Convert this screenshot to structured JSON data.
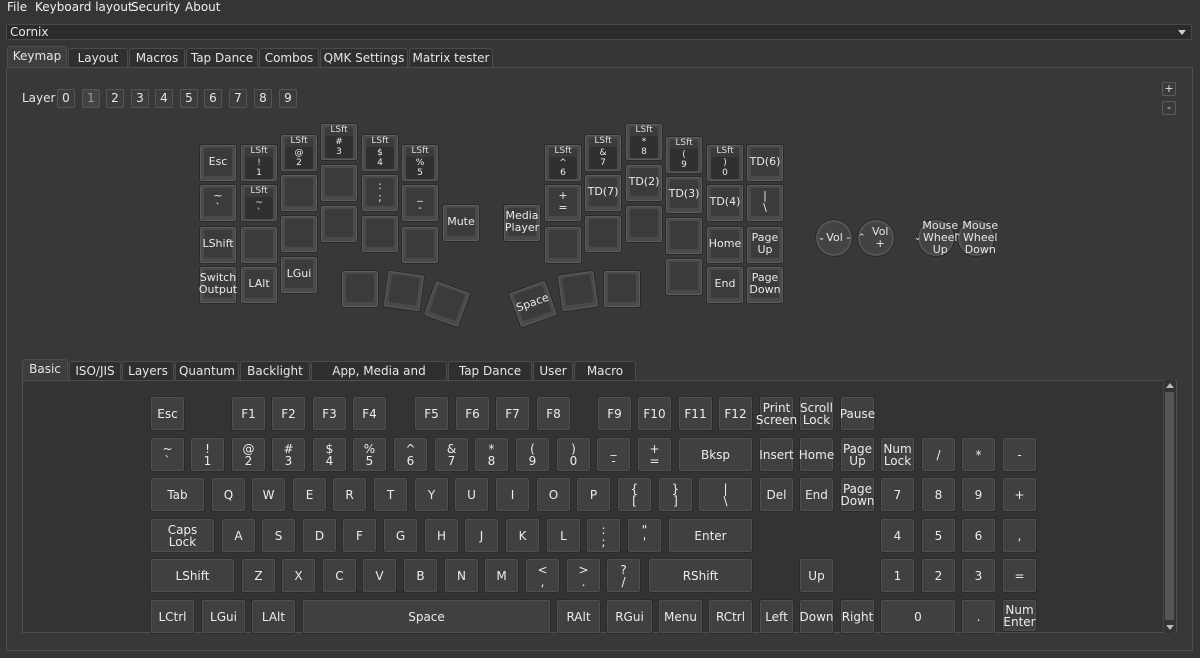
{
  "menu": [
    "File",
    "Keyboard layout",
    "Security",
    "About"
  ],
  "device": "Cornix",
  "top_tabs": [
    "Keymap",
    "Layout",
    "Macros",
    "Tap Dance",
    "Combos",
    "QMK Settings",
    "Matrix tester"
  ],
  "layer_label": "Layer",
  "layers": [
    "0",
    "1",
    "2",
    "3",
    "4",
    "5",
    "6",
    "7",
    "8",
    "9"
  ],
  "zoom_in": "+",
  "zoom_out": "-",
  "layout_keys": {
    "esc": "Esc",
    "lsft_1_mod": "LSft",
    "lsft_1_in": "!\n1",
    "lsft_2_mod": "LSft",
    "lsft_2_in": "@\n2",
    "lsft_3_mod": "LSft",
    "lsft_3_in": "#\n3",
    "lsft_4_mod": "LSft",
    "lsft_4_in": "$\n4",
    "lsft_5_mod": "LSft",
    "lsft_5_in": "%\n5",
    "grave": "~\n`",
    "lsft_grave_mod": "LSft",
    "lsft_grave_in": "~\n`",
    "semicolon": ":\n;",
    "minus": "_\n-",
    "lshift": "LShift",
    "switch_output": "Switch\nOutput",
    "lalt": "LAlt",
    "lgui": "LGui",
    "mute": "Mute",
    "media_player": "Media\nPlayer",
    "lsft_6_mod": "LSft",
    "lsft_6_in": "^\n6",
    "lsft_7_mod": "LSft",
    "lsft_7_in": "&\n7",
    "lsft_8_mod": "LSft",
    "lsft_8_in": "*\n8",
    "lsft_9_mod": "LSft",
    "lsft_9_in": "(\n9",
    "lsft_0_mod": "LSft",
    "lsft_0_in": ")\n0",
    "td6": "TD(6)",
    "equal": "+\n=",
    "td7": "TD(7)",
    "td2": "TD(2)",
    "td3": "TD(3)",
    "td4": "TD(4)",
    "backslash": "|\n\\",
    "home": "Home",
    "page_up": "Page\nUp",
    "end": "End",
    "page_down": "Page\nDown",
    "space": "Space",
    "enc_vol_down": "Vol -",
    "enc_vol_up": "Vol +",
    "enc_wheel_up": "Mouse\nWheel\nUp",
    "enc_wheel_down": "Mouse\nWheel\nDown"
  },
  "bottom_tabs": [
    "Basic",
    "ISO/JIS",
    "Layers",
    "Quantum",
    "Backlight",
    "App, Media and Mouse",
    "Tap Dance",
    "User",
    "Macro"
  ],
  "basic_keys": {
    "esc": "Esc",
    "f1": "F1",
    "f2": "F2",
    "f3": "F3",
    "f4": "F4",
    "f5": "F5",
    "f6": "F6",
    "f7": "F7",
    "f8": "F8",
    "f9": "F9",
    "f10": "F10",
    "f11": "F11",
    "f12": "F12",
    "print_screen": "Print\nScreen",
    "scroll_lock": "Scroll\nLock",
    "pause": "Pause",
    "grave": "~\n`",
    "k1": "!\n1",
    "k2": "@\n2",
    "k3": "#\n3",
    "k4": "$\n4",
    "k5": "%\n5",
    "k6": "^\n6",
    "k7": "&\n7",
    "k8": "*\n8",
    "k9": "(\n9",
    "k0": ")\n0",
    "minus": "_\n-",
    "equal": "+\n=",
    "bksp": "Bksp",
    "insert": "Insert",
    "home": "Home",
    "page_up": "Page\nUp",
    "num_lock": "Num\nLock",
    "kp_slash": "/",
    "kp_star": "*",
    "kp_minus": "-",
    "tab": "Tab",
    "q": "Q",
    "w": "W",
    "e": "E",
    "r": "R",
    "t": "T",
    "y": "Y",
    "u": "U",
    "i": "I",
    "o": "O",
    "p": "P",
    "lbracket": "{\n[",
    "rbracket": "}\n]",
    "backslash": "|\n\\",
    "del": "Del",
    "end": "End",
    "page_down": "Page\nDown",
    "kp7": "7",
    "kp8": "8",
    "kp9": "9",
    "kp_plus": "+",
    "caps_lock": "Caps\nLock",
    "a": "A",
    "s": "S",
    "d": "D",
    "f": "F",
    "g": "G",
    "h": "H",
    "j": "J",
    "k": "K",
    "l": "L",
    "semicolon": ":\n;",
    "quote": "\"\n'",
    "enter": "Enter",
    "kp4": "4",
    "kp5": "5",
    "kp6": "6",
    "kp_comma": ",",
    "lshift": "LShift",
    "z": "Z",
    "x": "X",
    "c": "C",
    "v": "V",
    "b": "B",
    "n": "N",
    "m": "M",
    "comma": "<\n,",
    "period": ">\n.",
    "slash": "?\n/",
    "rshift": "RShift",
    "up": "Up",
    "kp1": "1",
    "kp2": "2",
    "kp3": "3",
    "kp_equal": "=",
    "lctrl": "LCtrl",
    "lgui": "LGui",
    "lalt": "LAlt",
    "space": "Space",
    "ralt": "RAlt",
    "rgui": "RGui",
    "menu": "Menu",
    "rctrl": "RCtrl",
    "left": "Left",
    "down": "Down",
    "right": "Right",
    "kp0": "0",
    "kp_dot": ".",
    "num_enter": "Num\nEnter"
  }
}
